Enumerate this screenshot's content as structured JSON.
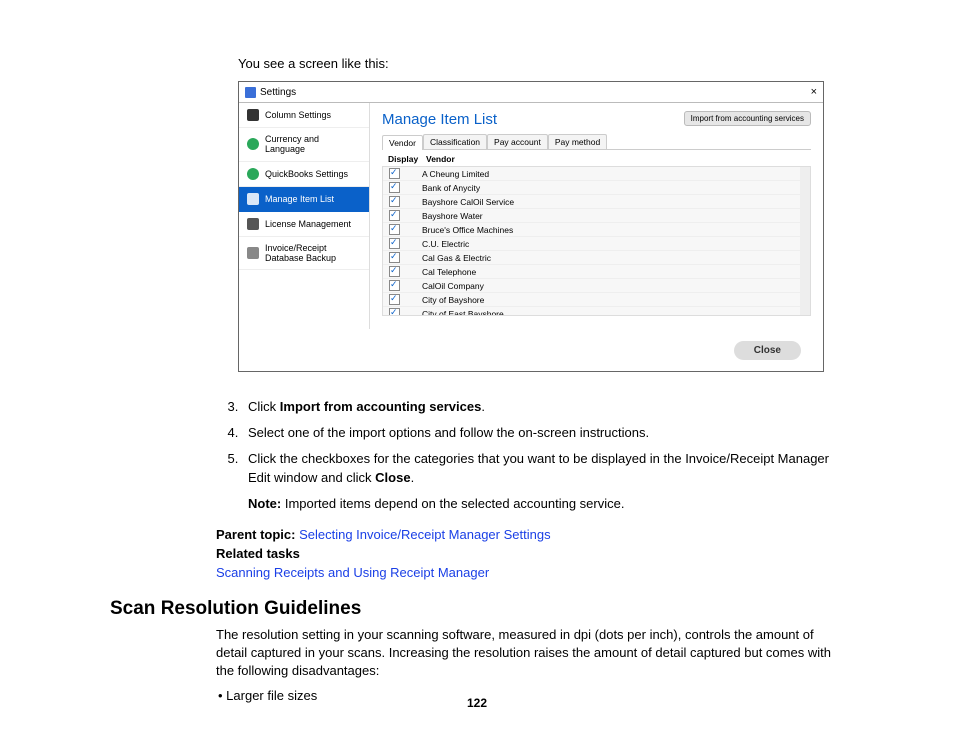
{
  "intro": "You see a screen like this:",
  "dialog": {
    "title": "Settings",
    "sidebar": [
      "Column Settings",
      "Currency and Language",
      "QuickBooks Settings",
      "Manage Item List",
      "License Management",
      "Invoice/Receipt Database Backup"
    ],
    "heading": "Manage Item List",
    "import_btn": "Import from accounting services",
    "tabs": [
      "Vendor",
      "Classification",
      "Pay account",
      "Pay method"
    ],
    "col1": "Display",
    "col2": "Vendor",
    "vendors": [
      "A Cheung Limited",
      "Bank of Anycity",
      "Bayshore CalOil Service",
      "Bayshore Water",
      "Bruce's Office Machines",
      "C.U. Electric",
      "Cal Gas & Electric",
      "Cal Telephone",
      "CalOil Company",
      "City of Bayshore",
      "City of East Bayshore"
    ],
    "close": "Close"
  },
  "steps": {
    "s3a": "Click ",
    "s3b": "Import from accounting services",
    "s3c": ".",
    "s4": "Select one of the import options and follow the on-screen instructions.",
    "s5a": "Click the checkboxes for the categories that you want to be displayed in the Invoice/Receipt Manager Edit window and click ",
    "s5b": "Close",
    "s5c": ".",
    "note_label": "Note:",
    "note_body": " Imported items depend on the selected accounting service."
  },
  "parent": {
    "label": "Parent topic:",
    "link": "Selecting Invoice/Receipt Manager Settings",
    "related_label": "Related tasks",
    "related_link": "Scanning Receipts and Using Receipt Manager"
  },
  "section": {
    "heading": "Scan Resolution Guidelines",
    "body": "The resolution setting in your scanning software, measured in dpi (dots per inch), controls the amount of detail captured in your scans. Increasing the resolution raises the amount of detail captured but comes with the following disadvantages:",
    "bullet1": "Larger file sizes"
  },
  "page_number": "122"
}
